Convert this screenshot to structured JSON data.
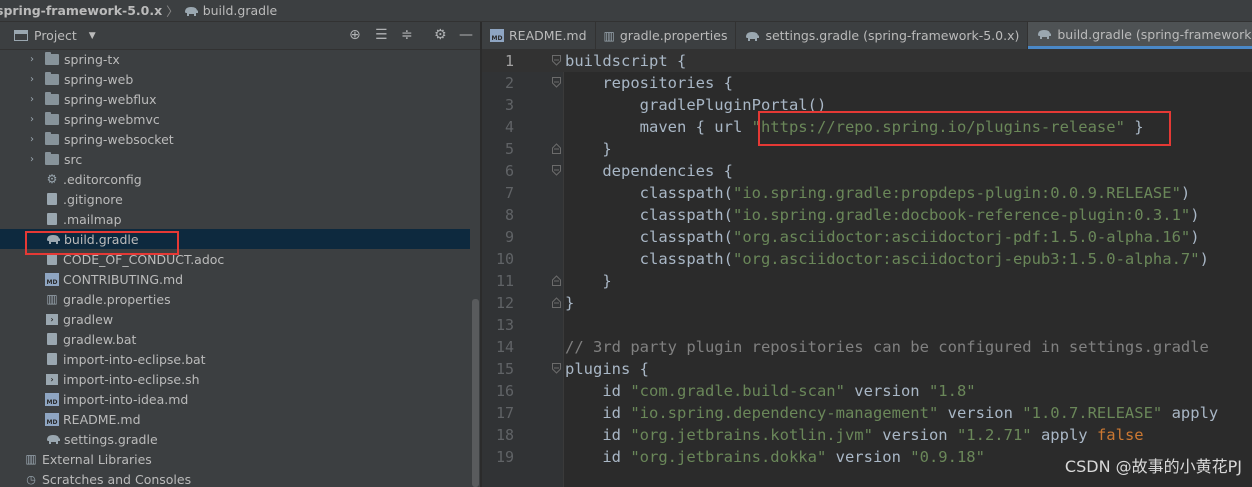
{
  "breadcrumb": {
    "project": "spring-framework-5.0.x",
    "file": "build.gradle"
  },
  "project_panel": {
    "label": "Project",
    "tools": [
      "crosshair-icon",
      "collapse-all-icon",
      "expand-all-icon",
      "gear-icon",
      "minimize-icon"
    ],
    "tree": [
      {
        "label": "spring-tx",
        "type": "folder"
      },
      {
        "label": "spring-web",
        "type": "folder"
      },
      {
        "label": "spring-webflux",
        "type": "folder"
      },
      {
        "label": "spring-webmvc",
        "type": "folder"
      },
      {
        "label": "spring-websocket",
        "type": "folder"
      },
      {
        "label": "src",
        "type": "folder"
      },
      {
        "label": ".editorconfig",
        "type": "gear-file"
      },
      {
        "label": ".gitignore",
        "type": "doc"
      },
      {
        "label": ".mailmap",
        "type": "doc"
      },
      {
        "label": "build.gradle",
        "type": "gradle",
        "selected": true
      },
      {
        "label": "CODE_OF_CONDUCT.adoc",
        "type": "doc"
      },
      {
        "label": "CONTRIBUTING.md",
        "type": "md"
      },
      {
        "label": "gradle.properties",
        "type": "properties"
      },
      {
        "label": "gradlew",
        "type": "shell"
      },
      {
        "label": "gradlew.bat",
        "type": "doc"
      },
      {
        "label": "import-into-eclipse.bat",
        "type": "doc"
      },
      {
        "label": "import-into-eclipse.sh",
        "type": "shell"
      },
      {
        "label": "import-into-idea.md",
        "type": "md"
      },
      {
        "label": "README.md",
        "type": "md"
      },
      {
        "label": "settings.gradle",
        "type": "gradle"
      },
      {
        "label": "External Libraries",
        "type": "libraries"
      },
      {
        "label": "Scratches and Consoles",
        "type": "scratches"
      }
    ]
  },
  "editor": {
    "tabs": [
      {
        "label": "README.md",
        "icon": "md"
      },
      {
        "label": "gradle.properties",
        "icon": "properties"
      },
      {
        "label": "settings.gradle (spring-framework-5.0.x)",
        "icon": "gradle"
      },
      {
        "label": "build.gradle (spring-framework",
        "icon": "gradle",
        "active": true
      }
    ],
    "lines": [
      {
        "n": "1",
        "indent": "",
        "parts": [
          [
            "k",
            "buildscript {"
          ]
        ]
      },
      {
        "n": "2",
        "indent": "    ",
        "parts": [
          [
            "k",
            "repositories {"
          ]
        ]
      },
      {
        "n": "3",
        "indent": "        ",
        "parts": [
          [
            "k",
            "gradlePluginPortal()"
          ]
        ]
      },
      {
        "n": "4",
        "indent": "        ",
        "parts": [
          [
            "k",
            "maven { url "
          ],
          [
            "s",
            "\"https://repo.spring.io/plugins-release\""
          ],
          [
            "k",
            " }"
          ]
        ]
      },
      {
        "n": "5",
        "indent": "    ",
        "parts": [
          [
            "k",
            "}"
          ]
        ]
      },
      {
        "n": "6",
        "indent": "    ",
        "parts": [
          [
            "k",
            "dependencies {"
          ]
        ]
      },
      {
        "n": "7",
        "indent": "        ",
        "parts": [
          [
            "k",
            "classpath("
          ],
          [
            "s",
            "\"io.spring.gradle:propdeps-plugin:0.0.9.RELEASE\""
          ],
          [
            "k",
            ")"
          ]
        ]
      },
      {
        "n": "8",
        "indent": "        ",
        "parts": [
          [
            "k",
            "classpath("
          ],
          [
            "s",
            "\"io.spring.gradle:docbook-reference-plugin:0.3.1\""
          ],
          [
            "k",
            ")"
          ]
        ]
      },
      {
        "n": "9",
        "indent": "        ",
        "parts": [
          [
            "k",
            "classpath("
          ],
          [
            "s",
            "\"org.asciidoctor:asciidoctorj-pdf:1.5.0-alpha.16\""
          ],
          [
            "k",
            ")"
          ]
        ]
      },
      {
        "n": "10",
        "indent": "        ",
        "parts": [
          [
            "k",
            "classpath("
          ],
          [
            "s",
            "\"org.asciidoctor:asciidoctorj-epub3:1.5.0-alpha.7\""
          ],
          [
            "k",
            ")"
          ]
        ]
      },
      {
        "n": "11",
        "indent": "    ",
        "parts": [
          [
            "k",
            "}"
          ]
        ]
      },
      {
        "n": "12",
        "indent": "",
        "parts": [
          [
            "k",
            "}"
          ]
        ]
      },
      {
        "n": "13",
        "indent": "",
        "parts": []
      },
      {
        "n": "14",
        "indent": "",
        "parts": [
          [
            "c",
            "// 3rd party plugin repositories can be configured in settings.gradle"
          ]
        ]
      },
      {
        "n": "15",
        "indent": "",
        "parts": [
          [
            "k",
            "plugins {"
          ]
        ]
      },
      {
        "n": "16",
        "indent": "    ",
        "parts": [
          [
            "k",
            "id "
          ],
          [
            "s",
            "\"com.gradle.build-scan\""
          ],
          [
            "k",
            " version "
          ],
          [
            "s",
            "\"1.8\""
          ]
        ]
      },
      {
        "n": "17",
        "indent": "    ",
        "parts": [
          [
            "k",
            "id "
          ],
          [
            "s",
            "\"io.spring.dependency-management\""
          ],
          [
            "k",
            " version "
          ],
          [
            "s",
            "\"1.0.7.RELEASE\""
          ],
          [
            "k",
            " apply"
          ]
        ]
      },
      {
        "n": "18",
        "indent": "    ",
        "parts": [
          [
            "k",
            "id "
          ],
          [
            "s",
            "\"org.jetbrains.kotlin.jvm\""
          ],
          [
            "k",
            " version "
          ],
          [
            "s",
            "\"1.2.71\""
          ],
          [
            "k",
            " apply "
          ],
          [
            "kw",
            "false"
          ]
        ]
      },
      {
        "n": "19",
        "indent": "    ",
        "parts": [
          [
            "k",
            "id "
          ],
          [
            "s",
            "\"org.jetbrains.dokka\""
          ],
          [
            "k",
            " version "
          ],
          [
            "s",
            "\"0.9.18\""
          ]
        ]
      }
    ]
  },
  "watermark": "CSDN @故事的小黄花PJ",
  "colors": {
    "panel_bg": "#3c3f41",
    "editor_bg": "#2b2b2b",
    "string": "#6a8759",
    "comment": "#808080",
    "keyword": "#cc7832",
    "highlight_box": "#e53935"
  }
}
